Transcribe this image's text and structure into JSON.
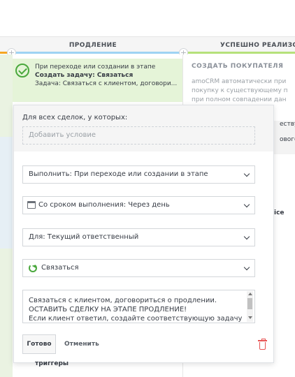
{
  "columns": {
    "prolongation": "ПРОДЛЕНИЕ",
    "success": "УСПЕШНО РЕАЛИЗОВ"
  },
  "trigger": {
    "line1": "При переходе или создании в этапе",
    "line2": "Создать задачу: Связаться",
    "line3": "Задача: Связаться с клиентом, договори..."
  },
  "right_col": {
    "title": "СОЗДАТЬ ПОКУПАТЕЛЯ",
    "text_lines": [
      "amoCRM автоматически при",
      "покупку к существующему п",
      "при полном совпадении дан"
    ],
    "extra_a": "еству",
    "extra_b": "ового",
    "bold": "ice"
  },
  "popup": {
    "condition_label": "Для всех сделок, у которых:",
    "condition_placeholder": "Добавить условие",
    "execute": "Выполнить: При переходе или создании в этапе",
    "deadline": "Со сроком выполнения: Через день",
    "for": "Для: Текущий ответственный",
    "task_type": "Связаться",
    "textarea_lines": [
      "Связаться с клиентом, договориться о продлении.",
      "ОСТАВИТЬ СДЕЛКУ НА ЭТАПЕ ПРОДЛЕНИЕ!",
      "Если клиент ответил, создайте соответствующую задачу"
    ],
    "done": "Готово",
    "cancel": "Отменить"
  },
  "below": "триггеры"
}
